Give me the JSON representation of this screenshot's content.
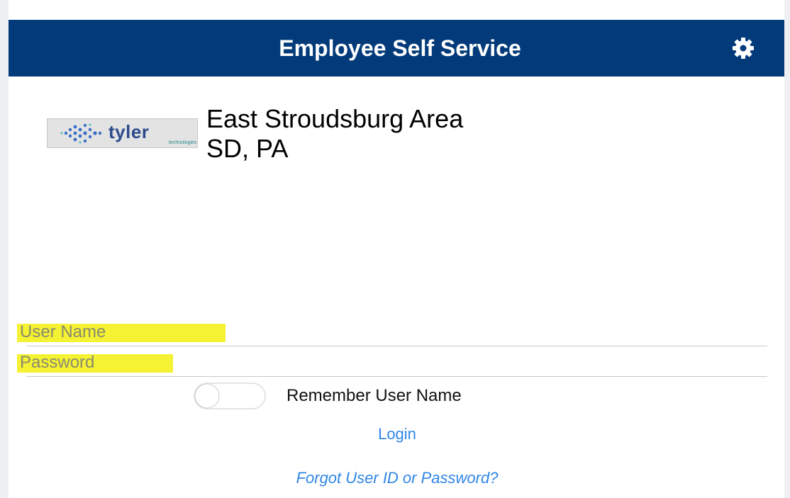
{
  "header": {
    "title": "Employee Self Service",
    "settings_icon": "gear-icon"
  },
  "logo": {
    "word": "tyler",
    "sub": "technologies",
    "dot_color": "#3b6fc7",
    "word_color": "#2d4b8c"
  },
  "organization": {
    "name_line1": "East Stroudsburg Area",
    "name_line2": "SD, PA"
  },
  "form": {
    "username_placeholder": "User Name",
    "username_value": "",
    "password_placeholder": "Password",
    "password_value": "",
    "remember_label": "Remember User Name",
    "remember_checked": false,
    "login_label": "Login",
    "forgot_label": "Forgot User ID or Password?"
  },
  "colors": {
    "header_bg": "#033b7a",
    "link": "#2f86e6",
    "highlight": "#f4f232"
  }
}
